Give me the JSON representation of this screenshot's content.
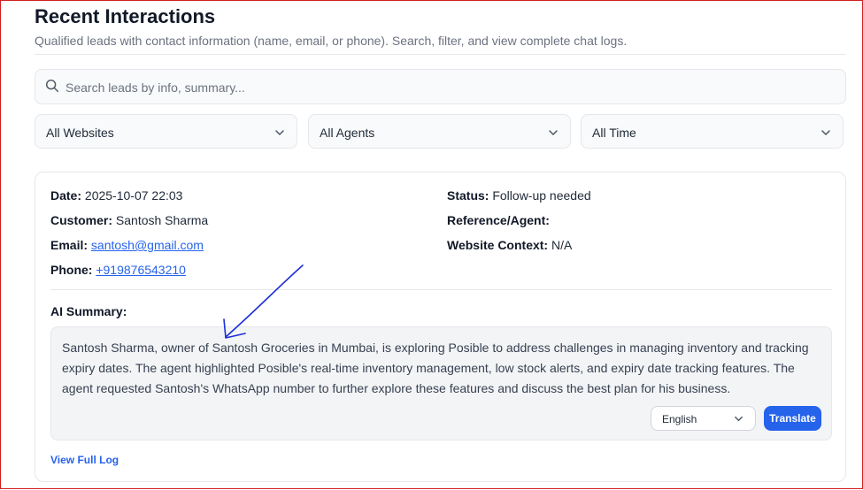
{
  "header": {
    "title": "Recent Interactions",
    "subtitle": "Qualified leads with contact information (name, email, or phone). Search, filter, and view complete chat logs."
  },
  "search": {
    "placeholder": "Search leads by info, summary..."
  },
  "filters": {
    "website": "All Websites",
    "agent": "All Agents",
    "time": "All Time"
  },
  "lead": {
    "date_label": "Date:",
    "date": "2025-10-07 22:03",
    "customer_label": "Customer:",
    "customer": "Santosh Sharma",
    "email_label": "Email:",
    "email": "santosh@gmail.com",
    "phone_label": "Phone:",
    "phone": "+919876543210",
    "status_label": "Status:",
    "status": "Follow-up needed",
    "reference_label": "Reference/Agent:",
    "reference": "",
    "website_context_label": "Website Context:",
    "website_context": "N/A",
    "ai_summary_label": "AI Summary:",
    "ai_summary": "Santosh Sharma, owner of Santosh Groceries in Mumbai, is exploring Posible to address challenges in managing inventory and tracking expiry dates. The agent highlighted Posible's real-time inventory management, low stock alerts, and expiry date tracking features. The agent requested Santosh's WhatsApp number to further explore these features and discuss the best plan for his business.",
    "language": "English",
    "translate_label": "Translate",
    "view_log_label": "View Full Log"
  },
  "colors": {
    "accent": "#2563eb",
    "annotation": "#1d2fd6",
    "window_border": "#d11f1f"
  },
  "icons": [
    "search-icon",
    "chevron-down-icon"
  ]
}
